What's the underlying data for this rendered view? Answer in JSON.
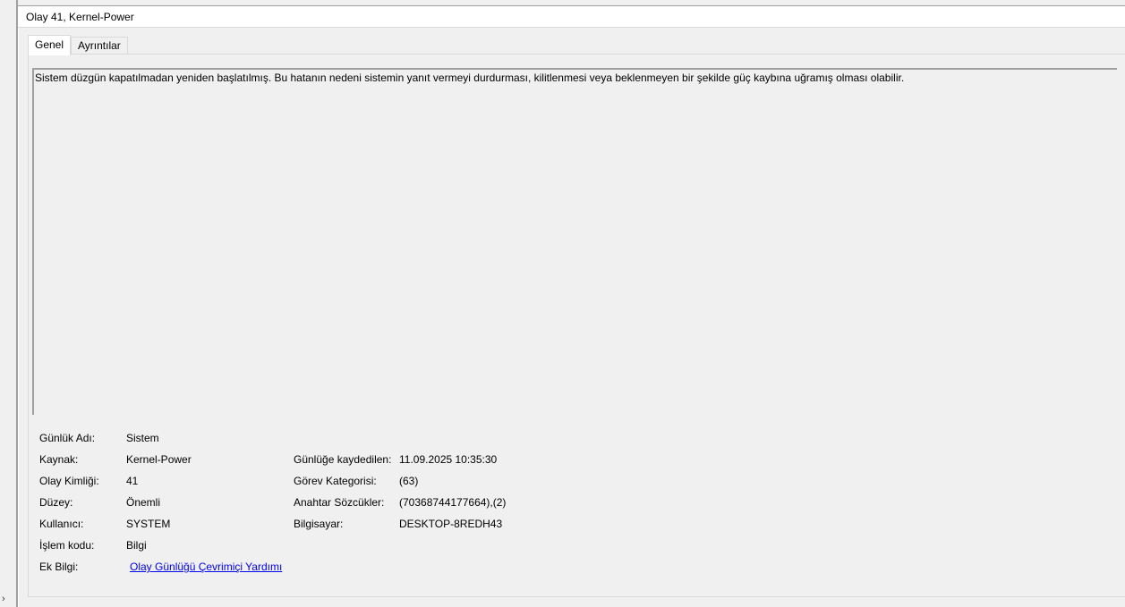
{
  "window": {
    "title": "Olay 41, Kernel-Power"
  },
  "tabs": [
    {
      "label": "Genel",
      "active": true
    },
    {
      "label": "Ayrıntılar",
      "active": false
    }
  ],
  "description": "Sistem düzgün kapatılmadan yeniden başlatılmış. Bu hatanın nedeni sistemin yanıt vermeyi durdurması, kilitlenmesi veya beklenmeyen bir şekilde güç kaybına uğramış olması olabilir.",
  "fields": {
    "log_name": {
      "label": "Günlük Adı:",
      "value": "Sistem"
    },
    "source": {
      "label": "Kaynak:",
      "value": "Kernel-Power"
    },
    "event_id": {
      "label": "Olay Kimliği:",
      "value": "41"
    },
    "level": {
      "label": "Düzey:",
      "value": "Önemli"
    },
    "user": {
      "label": "Kullanıcı:",
      "value": "SYSTEM"
    },
    "opcode": {
      "label": "İşlem kodu:",
      "value": "Bilgi"
    },
    "more_info": {
      "label": "Ek Bilgi:",
      "value": "Olay Günlüğü Çevrimiçi Yardımı"
    },
    "logged": {
      "label": "Günlüğe kaydedilen:",
      "value": "11.09.2025 10:35:30"
    },
    "task_category": {
      "label": "Görev Kategorisi:",
      "value": "(63)"
    },
    "keywords": {
      "label": "Anahtar Sözcükler:",
      "value": "(70368744177664),(2)"
    },
    "computer": {
      "label": "Bilgisayar:",
      "value": "DESKTOP-8REDH43"
    }
  },
  "icons": {
    "expand": "chevron-right-icon"
  }
}
